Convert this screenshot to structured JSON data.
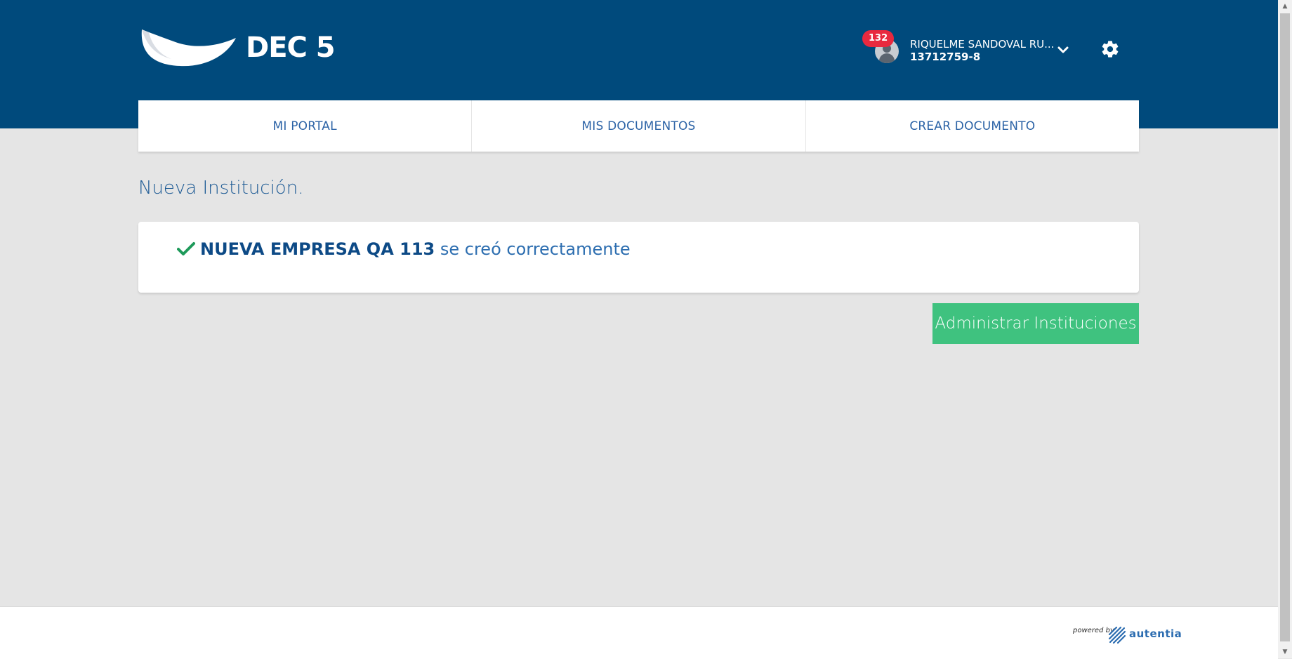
{
  "header": {
    "logo_text": "DEC 5",
    "notification_count": "132",
    "user_name": "RIQUELME SANDOVAL RU...",
    "user_id": "13712759-8"
  },
  "nav": {
    "tabs": [
      {
        "label": "MI PORTAL"
      },
      {
        "label": "MIS DOCUMENTOS"
      },
      {
        "label": "CREAR DOCUMENTO"
      }
    ]
  },
  "page": {
    "title": "Nueva Institución."
  },
  "message": {
    "institution_name": "NUEVA EMPRESA QA 113",
    "suffix": " se creó correctamente"
  },
  "actions": {
    "manage_label": "Administrar Instituciones"
  },
  "footer": {
    "powered_by": "powered by",
    "brand": "autentia"
  },
  "colors": {
    "header_bg": "#004a7c",
    "page_bg": "#e5e5e5",
    "success_green": "#3fc27f",
    "link_blue": "#2c63a6",
    "badge_red": "#e8293f"
  }
}
